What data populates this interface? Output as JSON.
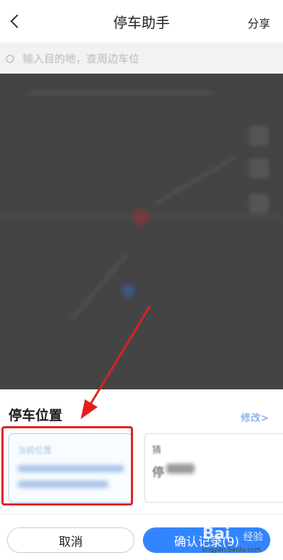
{
  "header": {
    "title": "停车助手",
    "share_label": "分享"
  },
  "search": {
    "placeholder": "输入目的地，查周边车位"
  },
  "sheet": {
    "title": "停车位置",
    "modify_label": "修改>",
    "current_card": {
      "label": "当前位置"
    },
    "guess_card": {
      "label": "猜",
      "value": "停"
    }
  },
  "buttons": {
    "cancel_label": "取消",
    "confirm_label": "确认记录(9)"
  },
  "watermark": {
    "brand": "Bai",
    "brand_cn": "经验",
    "url": "jingyan.baidu.com"
  },
  "colors": {
    "accent": "#3385ff",
    "annotation": "#e02020"
  }
}
